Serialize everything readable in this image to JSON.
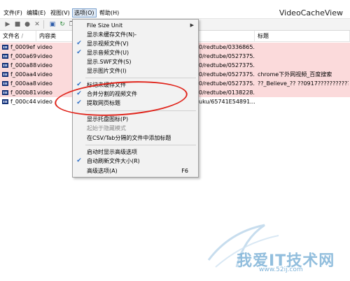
{
  "window": {
    "title": "VideoCacheView"
  },
  "menubar": {
    "items": [
      {
        "label": "文件(F)"
      },
      {
        "label": "编辑(E)"
      },
      {
        "label": "视图(V)"
      },
      {
        "label": "选项(O)"
      },
      {
        "label": "帮助(H)"
      }
    ]
  },
  "toolbar": {
    "icons": [
      "play-icon",
      "stop-icon",
      "record-icon",
      "delete-icon",
      "save-icon",
      "refresh-icon",
      "copy-icon",
      "properties-icon"
    ]
  },
  "list": {
    "columns": [
      {
        "label": "文件名"
      },
      {
        "label": "内容类"
      },
      {
        "label": ""
      },
      {
        "label": "标题"
      }
    ],
    "rows": [
      {
        "name": "f_0009ef",
        "type": "video",
        "url": "0/redtube/0336865...",
        "title": "",
        "highlight": true
      },
      {
        "name": "f_000a69",
        "type": "video",
        "url": "0/redtube/0527375...",
        "title": "",
        "highlight": true
      },
      {
        "name": "f_000a88",
        "type": "video",
        "url": "0/redtube/0527375...",
        "title": "",
        "highlight": true
      },
      {
        "name": "f_000aa4",
        "type": "video",
        "url": "0/redtube/0527375...",
        "title": "chrome下外网视频_百度搜索",
        "highlight": true
      },
      {
        "name": "f_000aa8",
        "type": "video",
        "url": "0/redtube/0527375...",
        "title": "??_Believe_?? ??0917???????????????",
        "highlight": true
      },
      {
        "name": "f_000b81",
        "type": "video",
        "url": "0/redtube/0138228...",
        "title": "",
        "highlight": true
      },
      {
        "name": "f_000c44",
        "type": "video",
        "url": "uku/65741E54891...",
        "title": "",
        "highlight": false
      }
    ]
  },
  "dropdown": {
    "items": [
      {
        "label": "File Size Unit",
        "checked": false,
        "disabled": false,
        "submenu": true,
        "shortcut": ""
      },
      {
        "label": "显示未缓存文件(N)-",
        "checked": false,
        "disabled": false,
        "submenu": false,
        "shortcut": ""
      },
      {
        "label": "显示视频文件(V)",
        "checked": true,
        "disabled": false,
        "submenu": false,
        "shortcut": ""
      },
      {
        "label": "显示音频文件(U)",
        "checked": true,
        "disabled": false,
        "submenu": false,
        "shortcut": ""
      },
      {
        "label": "显示.SWF文件(S)",
        "checked": false,
        "disabled": false,
        "submenu": false,
        "shortcut": ""
      },
      {
        "label": "显示图片文件(I)",
        "checked": false,
        "disabled": false,
        "submenu": false,
        "shortcut": ""
      },
      {
        "label": "标记未缓存文件",
        "checked": true,
        "disabled": false,
        "submenu": false,
        "shortcut": ""
      },
      {
        "label": "合并分割的视频文件",
        "checked": true,
        "disabled": false,
        "submenu": false,
        "shortcut": ""
      },
      {
        "label": "提取网页标题",
        "checked": true,
        "disabled": false,
        "submenu": false,
        "shortcut": ""
      },
      {
        "label": "显示托盘图标(P)",
        "checked": false,
        "disabled": false,
        "submenu": false,
        "shortcut": ""
      },
      {
        "label": "起始于隐藏模式",
        "checked": false,
        "disabled": true,
        "submenu": false,
        "shortcut": ""
      },
      {
        "label": "在CSV/Tab分隔的文件中添加标题",
        "checked": false,
        "disabled": false,
        "submenu": false,
        "shortcut": ""
      },
      {
        "label": "启动时显示高级选项",
        "checked": false,
        "disabled": false,
        "submenu": false,
        "shortcut": ""
      },
      {
        "label": "自动刷新文件大小(R)",
        "checked": true,
        "disabled": false,
        "submenu": false,
        "shortcut": ""
      },
      {
        "label": "高级选项(A)",
        "checked": false,
        "disabled": false,
        "submenu": false,
        "shortcut": "F6"
      }
    ]
  },
  "watermark": {
    "text": "我爱IT技术网",
    "sub": "www.52ij.com"
  },
  "colors": {
    "highlight_row": "#fbdadb",
    "annotation": "#e0251c",
    "check": "#2f6fc6",
    "watermark": "#7fb3d8"
  }
}
